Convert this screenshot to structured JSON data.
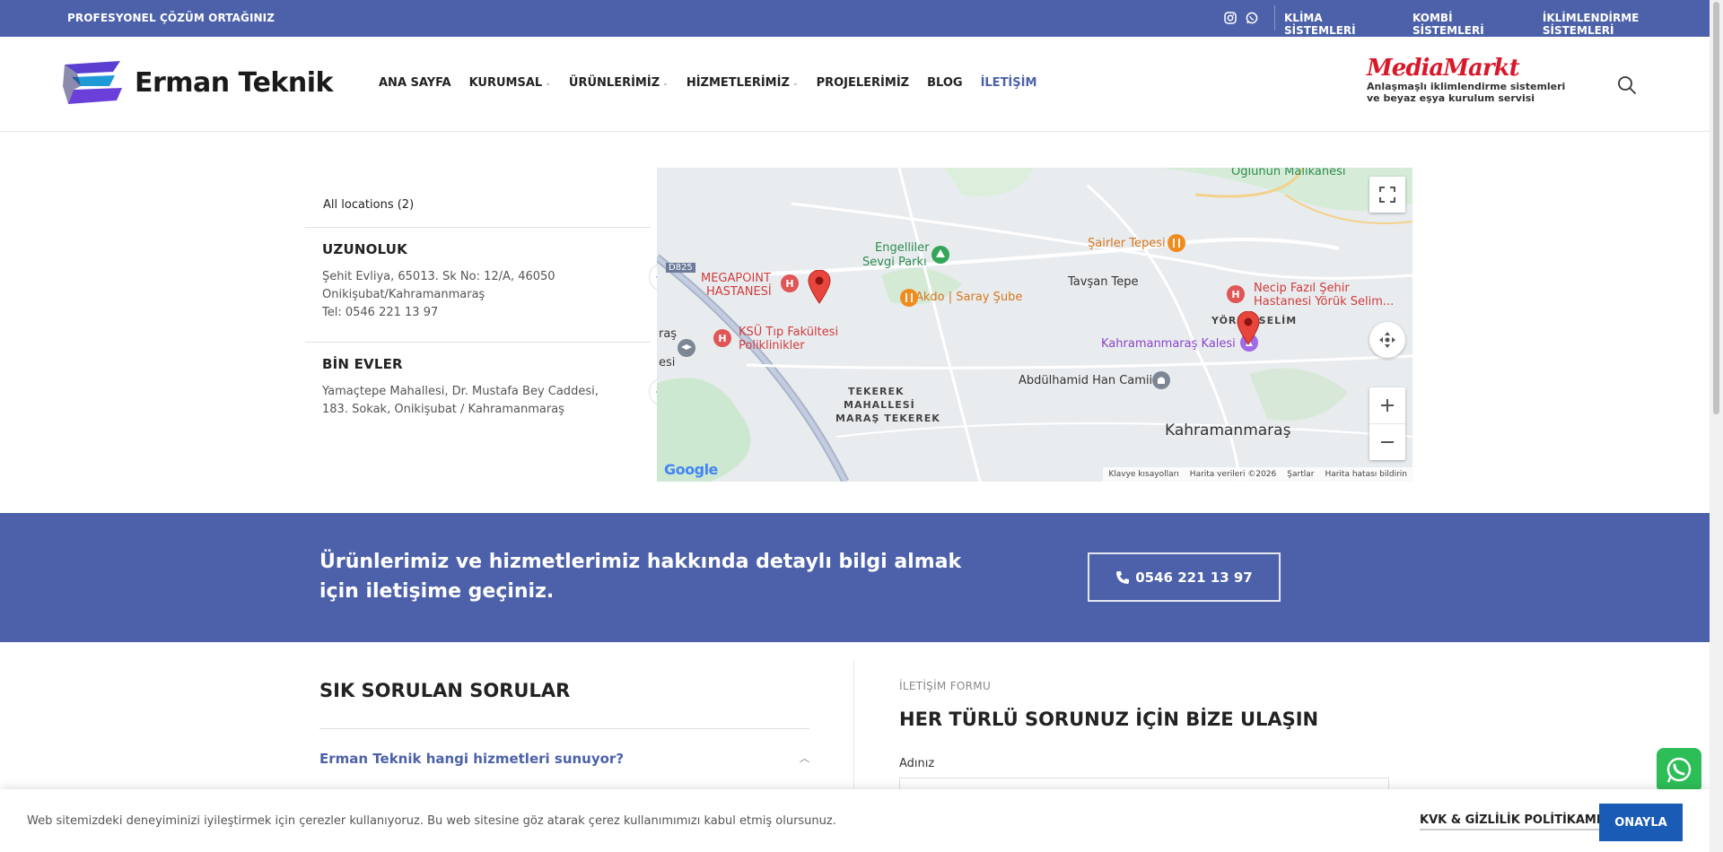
{
  "topbar": {
    "tagline": "PROFESYONEL ÇÖZÜM ORTAĞINIZ",
    "links": [
      "KLİMA SİSTEMLERİ",
      "KOMBİ SİSTEMLERİ",
      "İKLİMLENDİRME SİSTEMLERİ"
    ],
    "social_icons": [
      "instagram-icon",
      "whatsapp-icon"
    ]
  },
  "header": {
    "logo_text": "Erman Teknik",
    "nav": [
      {
        "label": "ANA SAYFA",
        "has_submenu": false
      },
      {
        "label": "KURUMSAL",
        "has_submenu": true
      },
      {
        "label": "ÜRÜNLERİMİZ",
        "has_submenu": true
      },
      {
        "label": "HİZMETLERİMİZ",
        "has_submenu": true
      },
      {
        "label": "PROJELERİMİZ",
        "has_submenu": false
      },
      {
        "label": "BLOG",
        "has_submenu": false
      },
      {
        "label": "İLETİŞİM",
        "has_submenu": false,
        "active": true
      }
    ],
    "partner": {
      "brand": "MediaMarkt",
      "line1": "Anlaşmaşlı iklimlendirme sistemleri",
      "line2": "ve beyaz eşya kurulum servisi"
    }
  },
  "locations": {
    "all_label": "All locations (2)",
    "items": [
      {
        "name": "UZUNOLUK",
        "line1": "Şehit Evliya, 65013. Sk No: 12/A, 46050",
        "line2": "Onikişubat/Kahramanmaraş",
        "line3": "Tel: 0546 221 13 97"
      },
      {
        "name": "BİN EVLER",
        "line1": "Yamaçtepe Mahallesi, Dr. Mustafa Bey Caddesi,",
        "line2": "183. Sokak, Onikişubat / Kahramanmaraş",
        "line3": ""
      }
    ]
  },
  "map": {
    "labels": {
      "oglunun": "Oğlunun Malikanesi",
      "sairler": "Şairler Tepesi",
      "engelliler1": "Engelliler",
      "engelliler2": "Sevgi Parkı",
      "megapoint1": "MEGAPOINT",
      "megapoint2": "HASTANESİ",
      "akdo": "Akdo | Saray Şube",
      "tavsan": "Tavşan Tepe",
      "necip1": "Necip Fazıl Şehir",
      "necip2": "Hastanesi Yörük Selim...",
      "yoruk": "YÖRÜK SELİM",
      "ksu1": "KSÜ Tıp Fakültesi",
      "ksu2": "Poliklinikler",
      "kale": "Kahramanmaraş Kalesi",
      "abdul": "Abdülhamid Han Camii",
      "tekerek1": "TEKEREK",
      "tekerek2": "MAHALLESİ",
      "tekerek3": "MARAŞ TEKEREK",
      "city": "Kahramanmaraş",
      "road": "D825",
      "edge1": "raş",
      "edge2": "esi"
    },
    "attribution": [
      "Klavye kısayolları",
      "Harita verileri ©2026",
      "Şartlar",
      "Harita hatası bildirin"
    ],
    "google": "Google"
  },
  "cta": {
    "message": "Ürünlerimiz ve hizmetlerimiz hakkında detaylı bilgi almak için iletişime geçiniz.",
    "phone": "0546 221 13 97"
  },
  "faq": {
    "title": "SIK SORULAN SORULAR",
    "question": "Erman Teknik hangi hizmetleri sunuyor?"
  },
  "form": {
    "kicker": "İLETİŞİM FORMU",
    "title": "HER TÜRLÜ SORUNUZ İÇİN BİZE ULAŞIN",
    "name_label": "Adınız"
  },
  "cookie": {
    "text": "Web sitemizdeki deneyiminizi iyileştirmek için çerezler kullanıyoruz. Bu web sitesine göz atarak çerez kullanımımızı kabul etmiş olursunuz.",
    "policy": "KVK & GİZLİLİK POLİTİKAMIZ",
    "accept": "ONAYLA"
  },
  "colors": {
    "primary": "#4c61a9",
    "accent_red": "#d7192b",
    "button_blue": "#1a5bb5",
    "whatsapp": "#2dbe57"
  }
}
